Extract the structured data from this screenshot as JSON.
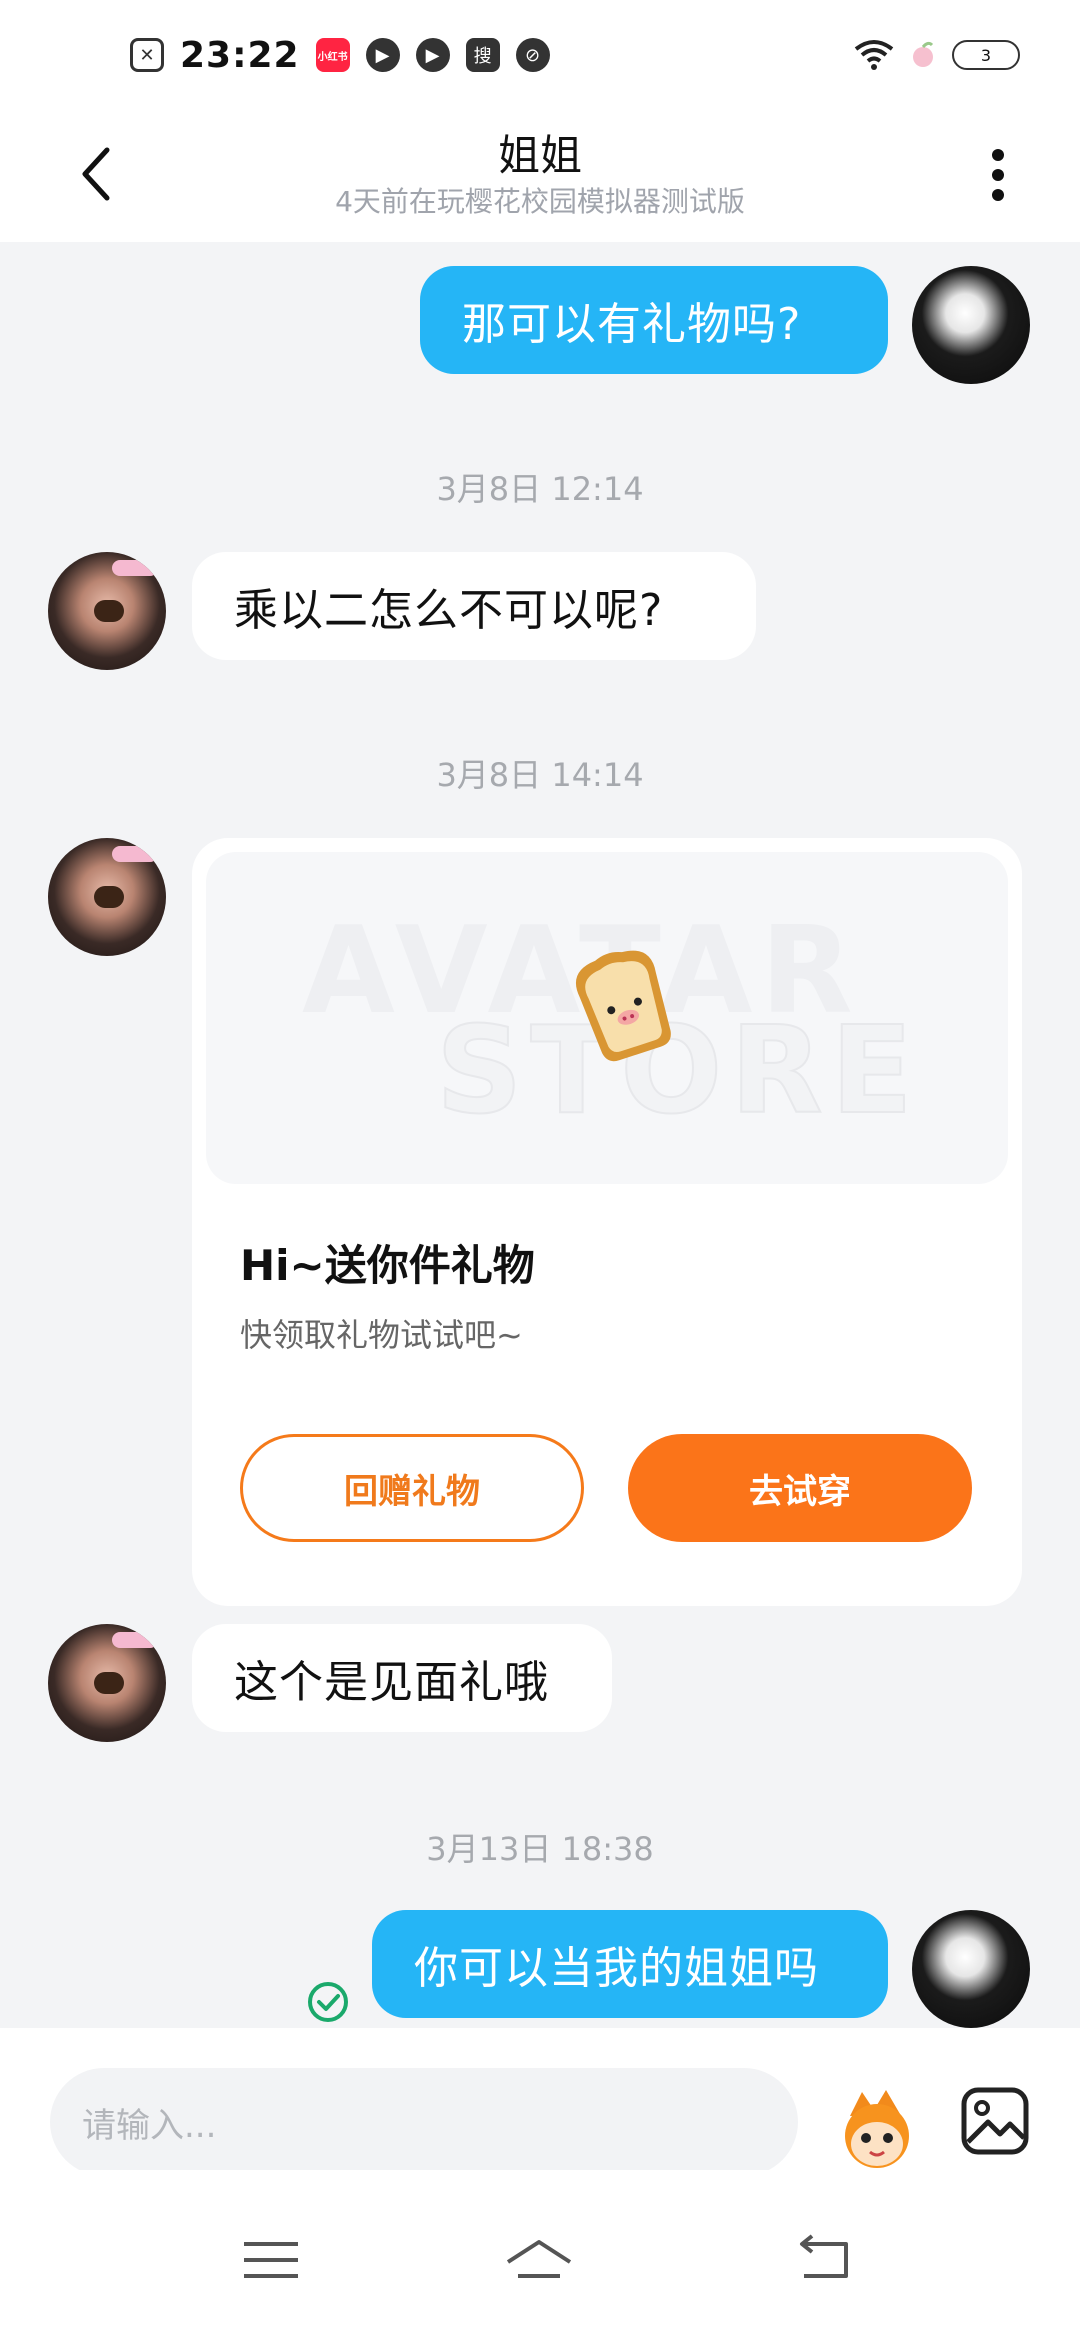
{
  "status_bar": {
    "time": "23:22",
    "battery": "3",
    "app_icons": [
      "file-x-icon",
      "xiaohongshu-icon",
      "play-icon",
      "play-icon",
      "search-app-icon",
      "leaf-icon"
    ]
  },
  "header": {
    "title": "姐姐",
    "subtitle": "4天前在玩樱花校园模拟器测试版"
  },
  "messages": {
    "m1": "那可以有礼物吗?",
    "ts1": "3月8日 12:14",
    "m2": "乘以二怎么不可以呢?",
    "ts2": "3月8日 14:14",
    "gift": {
      "title": "Hi~送你件礼物",
      "desc": "快领取礼物试试吧~",
      "watermark_1": "AVATAR",
      "watermark_2": "STORE",
      "return_label": "回赠礼物",
      "try_label": "去试穿"
    },
    "m3": "这个是见面礼哦",
    "ts3": "3月13日 18:38",
    "m4": "你可以当我的姐姐吗"
  },
  "input": {
    "placeholder": "请输入..."
  },
  "colors": {
    "my_bubble": "#25b5f6",
    "accent_orange": "#fb7419",
    "background": "#f3f4f6"
  }
}
